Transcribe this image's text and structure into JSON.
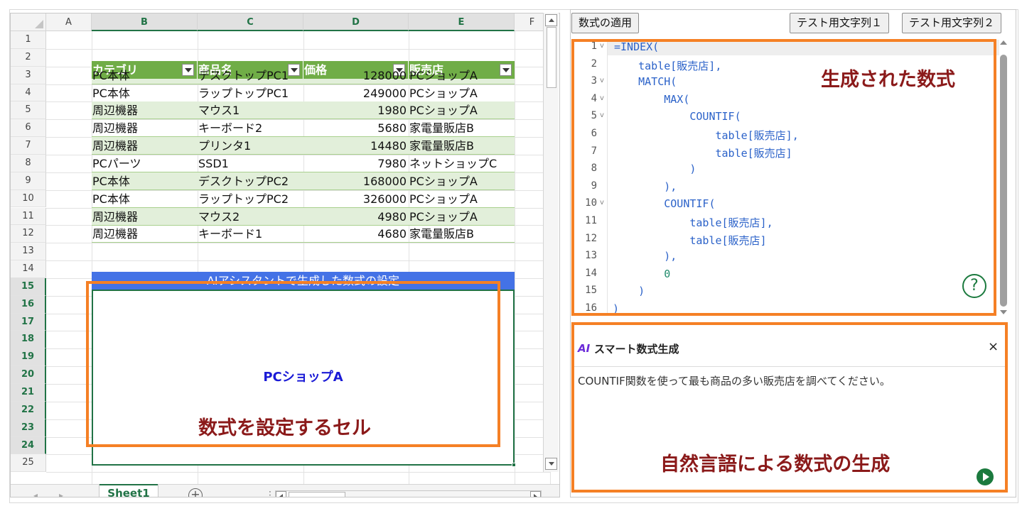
{
  "spreadsheet": {
    "columns": [
      "A",
      "B",
      "C",
      "D",
      "E",
      "F"
    ],
    "rows": [
      "1",
      "2",
      "3",
      "4",
      "5",
      "6",
      "7",
      "8",
      "9",
      "10",
      "11",
      "12",
      "13",
      "14",
      "15",
      "16",
      "17",
      "18",
      "19",
      "20",
      "21",
      "22",
      "23",
      "24",
      "25"
    ],
    "table_headers": [
      "カテゴリ",
      "商品名",
      "価格",
      "販売店"
    ],
    "table_rows": [
      [
        "PC本体",
        "デスクトップPC1",
        "128000",
        "PCショップA"
      ],
      [
        "PC本体",
        "ラップトップPC1",
        "249000",
        "PCショップA"
      ],
      [
        "周辺機器",
        "マウス1",
        "1980",
        "PCショップA"
      ],
      [
        "周辺機器",
        "キーボード2",
        "5680",
        "家電量販店B"
      ],
      [
        "周辺機器",
        "プリンタ1",
        "14480",
        "家電量販店B"
      ],
      [
        "PCパーツ",
        "SSD1",
        "7980",
        "ネットショップC"
      ],
      [
        "PC本体",
        "デスクトップPC2",
        "168000",
        "PCショップA"
      ],
      [
        "PC本体",
        "ラップトップPC2",
        "326000",
        "PCショップA"
      ],
      [
        "周辺機器",
        "マウス2",
        "4980",
        "PCショップA"
      ],
      [
        "周辺機器",
        "キーボード1",
        "4680",
        "家電量販店B"
      ]
    ],
    "merged_title": "AIアシスタントで生成した数式の設定",
    "result_value": "PCショップA",
    "sheet_tab": "Sheet1",
    "add_sheet_symbol": "+",
    "nav_prev": "◂",
    "nav_next": "▸",
    "overflow_symbol": "⋮"
  },
  "annotations": {
    "cell_label": "数式を設定するセル",
    "formula_label": "生成された数式",
    "nl_label": "自然言語による数式の生成"
  },
  "toolbar": {
    "apply_label": "数式の適用",
    "test1_label": "テスト用文字列１",
    "test2_label": "テスト用文字列２"
  },
  "editor": {
    "line_numbers": [
      "1",
      "2",
      "3",
      "4",
      "5",
      "6",
      "7",
      "8",
      "9",
      "10",
      "11",
      "12",
      "13",
      "14",
      "15",
      "16"
    ],
    "fold_markers": [
      "v",
      "",
      "v",
      "v",
      "v",
      "",
      "",
      "",
      "",
      "v",
      "",
      "",
      "",
      "",
      "",
      ""
    ],
    "lines": [
      "=INDEX(",
      "    table[販売店],",
      "    MATCH(",
      "        MAX(",
      "            COUNTIF(",
      "                table[販売店],",
      "                table[販売店]",
      "            )",
      "        ),",
      "        COUNTIF(",
      "            table[販売店],",
      "            table[販売店]",
      "        ),",
      "        0",
      "    )",
      ")"
    ],
    "help_symbol": "?"
  },
  "ai_panel": {
    "logo": "AI",
    "title": "スマート数式生成",
    "close_symbol": "×",
    "prompt": "COUNTIF関数を使って最も商品の多い販売店を調べてください。",
    "splitter": "•••"
  },
  "colors": {
    "table_header": "#70ad47",
    "band": "#e2efda",
    "merged_title": "#4472e6",
    "highlight_orange": "#f58025",
    "annotation_text": "#8b1a1a",
    "code_blue": "#2b62c9",
    "accent_green": "#217346"
  }
}
